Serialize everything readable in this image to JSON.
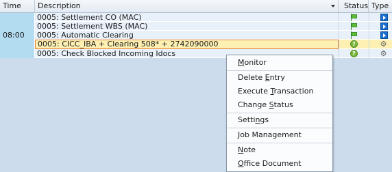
{
  "columns": {
    "time": "Time",
    "description": "Description",
    "status": "Status",
    "type": "Type"
  },
  "rows": [
    {
      "time": "",
      "description": "0005: Settlement CO (MAC)",
      "status_icon": "green-flag-icon",
      "type_icon": "blue-play-icon"
    },
    {
      "time": "",
      "description": "0005: Settlement WBS (MAC)",
      "status_icon": "green-flag-icon",
      "type_icon": "blue-play-icon"
    },
    {
      "time": "08:00",
      "description": "0005: Automatic Clearing",
      "status_icon": "green-flag-icon",
      "type_icon": "blue-play-icon"
    },
    {
      "time": "",
      "description": "0005: CICC_IBA + Clearing 508* + 2742090000",
      "status_icon": "question-icon",
      "type_icon": "gear-icon",
      "selected": true
    },
    {
      "time": "",
      "description": "0005: Check Blocked Incoming Idocs",
      "status_icon": "question-icon",
      "type_icon": "gear-icon"
    }
  ],
  "context_menu": {
    "items": [
      {
        "pre": "",
        "key": "M",
        "post": "onitor"
      },
      {
        "pre": "Delete ",
        "key": "E",
        "post": "ntry"
      },
      {
        "pre": "Execute ",
        "key": "T",
        "post": "ransaction"
      },
      {
        "pre": "Change ",
        "key": "S",
        "post": "tatus"
      },
      {
        "pre": "Setti",
        "key": "n",
        "post": "gs"
      },
      {
        "pre": "",
        "key": "J",
        "post": "ob Management"
      },
      {
        "pre": "",
        "key": "N",
        "post": "ote"
      },
      {
        "pre": "",
        "key": "O",
        "post": "ffice Document"
      }
    ]
  }
}
